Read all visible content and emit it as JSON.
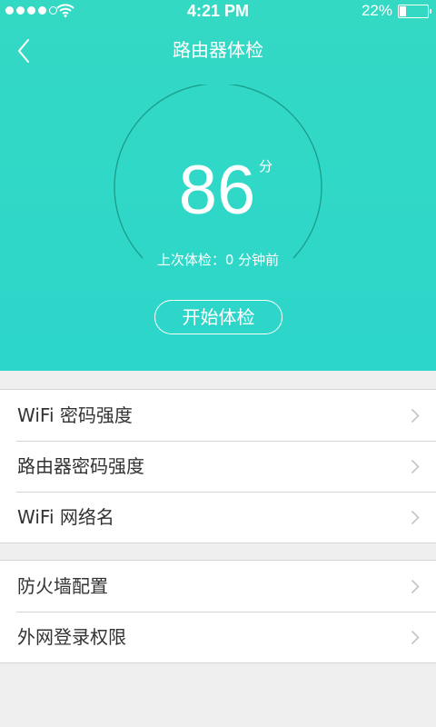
{
  "status_bar": {
    "time": "4:21 PM",
    "battery": "22%",
    "signal_bars_filled": 4,
    "signal_bars_total": 5
  },
  "nav": {
    "title": "路由器体检",
    "back_icon": "chevron-left-icon"
  },
  "checkup": {
    "score": "86",
    "score_unit": "分",
    "last_check": "上次体检：0 分钟前",
    "start_button": "开始体检"
  },
  "groups": [
    {
      "items": [
        {
          "label": "WiFi 密码强度"
        },
        {
          "label": "路由器密码强度"
        },
        {
          "label": "WiFi 网络名"
        }
      ]
    },
    {
      "items": [
        {
          "label": "防火墙配置"
        },
        {
          "label": "外网登录权限"
        }
      ]
    }
  ],
  "colors": {
    "accent": "#2fd8c8",
    "background": "#efefef",
    "text": "#333333",
    "divider": "#d4d4d4",
    "gauge_ring": "#1a9d8c"
  }
}
